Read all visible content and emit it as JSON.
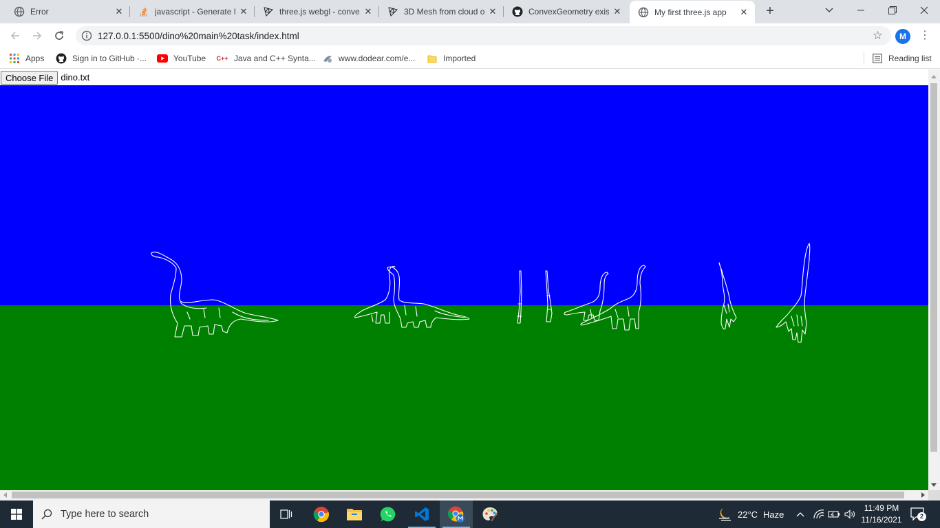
{
  "browser": {
    "tabs": [
      {
        "title": "Error",
        "icon": "globe-icon",
        "active": false
      },
      {
        "title": "javascript - Generate M",
        "icon": "stackoverflow-icon",
        "active": false
      },
      {
        "title": "three.js webgl - conve",
        "icon": "threejs-icon",
        "active": false
      },
      {
        "title": "3D Mesh from cloud o",
        "icon": "threejs-icon",
        "active": false
      },
      {
        "title": "ConvexGeometry exist",
        "icon": "github-icon",
        "active": false
      },
      {
        "title": "My first three.js app",
        "icon": "globe-icon",
        "active": true
      }
    ],
    "new_tab": "+",
    "url": "127.0.0.1:5500/dino%20main%20task/index.html",
    "profile_initial": "M",
    "bookmarks": [
      {
        "label": "Apps",
        "icon": "apps-grid-icon"
      },
      {
        "label": "Sign in to GitHub ·...",
        "icon": "github-icon"
      },
      {
        "label": "YouTube",
        "icon": "youtube-icon"
      },
      {
        "label": "Java and C++ Synta...",
        "icon": "cpp-icon"
      },
      {
        "label": "www.dodear.com/e...",
        "icon": "site-icon"
      },
      {
        "label": "Imported",
        "icon": "folder-icon"
      }
    ],
    "reading_list": "Reading list"
  },
  "page": {
    "choose_file_label": "Choose File",
    "file_name": "dino.txt",
    "scene": {
      "sky_color": "#0000ff",
      "ground_color": "#008000",
      "outline_color": "#ffffff"
    }
  },
  "taskbar": {
    "search_placeholder": "Type here to search",
    "weather": {
      "temp": "22°C",
      "condition": "Haze"
    },
    "time": "11:49 PM",
    "date": "11/16/2021",
    "notification_count": "2",
    "apps": [
      "task-view",
      "chrome",
      "file-explorer",
      "whatsapp",
      "vscode",
      "chrome-profile",
      "paint"
    ]
  }
}
